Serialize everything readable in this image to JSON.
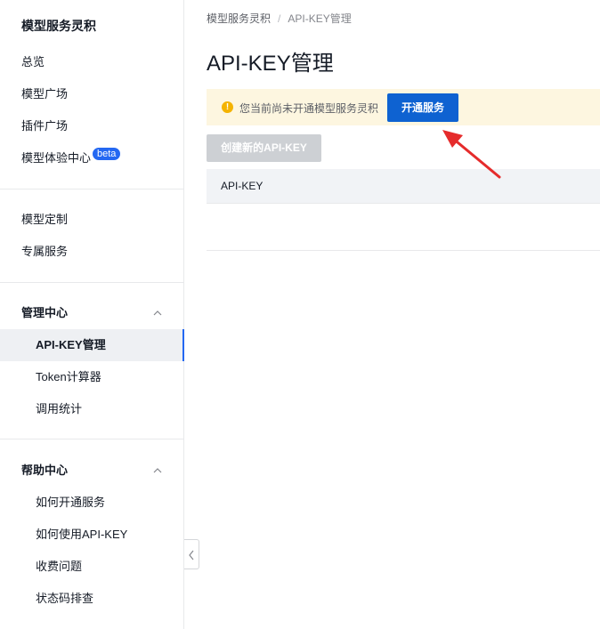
{
  "sidebar": {
    "title": "模型服务灵积",
    "top_items": [
      {
        "label": "总览"
      },
      {
        "label": "模型广场"
      },
      {
        "label": "插件广场"
      },
      {
        "label": "模型体验中心",
        "badge": "beta"
      }
    ],
    "custom_items": [
      {
        "label": "模型定制"
      },
      {
        "label": "专属服务"
      }
    ],
    "manage_group": {
      "label": "管理中心",
      "items": [
        {
          "label": "API-KEY管理",
          "active": true
        },
        {
          "label": "Token计算器"
        },
        {
          "label": "调用统计"
        }
      ]
    },
    "help_group": {
      "label": "帮助中心",
      "items": [
        {
          "label": "如何开通服务"
        },
        {
          "label": "如何使用API-KEY"
        },
        {
          "label": "收费问题"
        },
        {
          "label": "状态码排查"
        }
      ]
    }
  },
  "breadcrumb": {
    "root": "模型服务灵积",
    "separator": "/",
    "current": "API-KEY管理"
  },
  "page_title": "API-KEY管理",
  "notice": {
    "text": "您当前尚未开通模型服务灵积",
    "button_label": "开通服务",
    "icon": "warning-icon"
  },
  "create_button_label": "创建新的API-KEY",
  "table": {
    "columns": [
      "API-KEY"
    ]
  },
  "colors": {
    "primary": "#0e62d1",
    "active_marker": "#2468f2",
    "notice_bg": "#fdf6e0",
    "annotation_arrow": "#e52b2b"
  }
}
